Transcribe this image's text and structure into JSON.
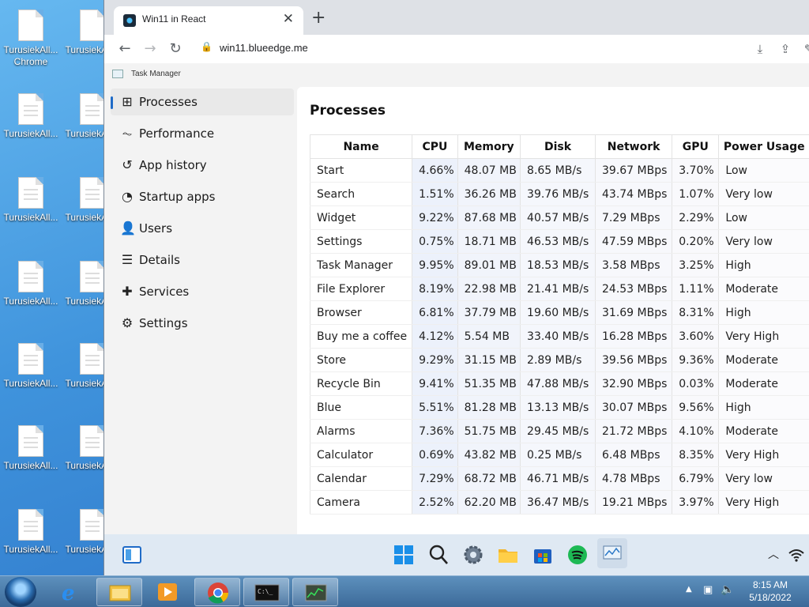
{
  "desktop": {
    "icons": [
      {
        "label": "TurusiekAll..."
      },
      {
        "label": "TurusiekAll..."
      },
      {
        "label": "TurusiekAll..."
      },
      {
        "label": "TurusiekAll..."
      },
      {
        "label": "TurusiekAll..."
      },
      {
        "label": "TurusiekAll..."
      },
      {
        "label": "TurusiekAll..."
      },
      {
        "label": "TurusiekAll..."
      },
      {
        "label": "TurusiekAll..."
      },
      {
        "label": "TurusiekAll..."
      },
      {
        "label": "TurusiekAll..."
      },
      {
        "label": "TurusiekAll..."
      }
    ],
    "chrome_label": "Chrome"
  },
  "browser": {
    "tab_title": "Win11 in React",
    "url": "win11.blueedge.me"
  },
  "taskmanager": {
    "title": "Task Manager",
    "nav": [
      {
        "label": "Processes",
        "icon": "grid-icon",
        "glyph": "⊞"
      },
      {
        "label": "Performance",
        "icon": "pulse-icon",
        "glyph": "⏦"
      },
      {
        "label": "App history",
        "icon": "history-icon",
        "glyph": "↺"
      },
      {
        "label": "Startup apps",
        "icon": "speedometer-icon",
        "glyph": "◔"
      },
      {
        "label": "Users",
        "icon": "user-icon",
        "glyph": "👤"
      },
      {
        "label": "Details",
        "icon": "list-icon",
        "glyph": "☰"
      },
      {
        "label": "Services",
        "icon": "puzzle-icon",
        "glyph": "✚"
      },
      {
        "label": "Settings",
        "icon": "gear-icon",
        "glyph": "⚙"
      }
    ],
    "heading": "Processes",
    "columns": [
      "Name",
      "CPU",
      "Memory",
      "Disk",
      "Network",
      "GPU",
      "Power Usage"
    ],
    "rows": [
      [
        "Start",
        "4.66%",
        "48.07 MB",
        "8.65 MB/s",
        "39.67 MBps",
        "3.70%",
        "Low"
      ],
      [
        "Search",
        "1.51%",
        "36.26 MB",
        "39.76 MB/s",
        "43.74 MBps",
        "1.07%",
        "Very low"
      ],
      [
        "Widget",
        "9.22%",
        "87.68 MB",
        "40.57 MB/s",
        "7.29 MBps",
        "2.29%",
        "Low"
      ],
      [
        "Settings",
        "0.75%",
        "18.71 MB",
        "46.53 MB/s",
        "47.59 MBps",
        "0.20%",
        "Very low"
      ],
      [
        "Task Manager",
        "9.95%",
        "89.01 MB",
        "18.53 MB/s",
        "3.58 MBps",
        "3.25%",
        "High"
      ],
      [
        "File Explorer",
        "8.19%",
        "22.98 MB",
        "21.41 MB/s",
        "24.53 MBps",
        "1.11%",
        "Moderate"
      ],
      [
        "Browser",
        "6.81%",
        "37.79 MB",
        "19.60 MB/s",
        "31.69 MBps",
        "8.31%",
        "High"
      ],
      [
        "Buy me a coffee",
        "4.12%",
        "5.54 MB",
        "33.40 MB/s",
        "16.28 MBps",
        "3.60%",
        "Very High"
      ],
      [
        "Store",
        "9.29%",
        "31.15 MB",
        "2.89 MB/s",
        "39.56 MBps",
        "9.36%",
        "Moderate"
      ],
      [
        "Recycle Bin",
        "9.41%",
        "51.35 MB",
        "47.88 MB/s",
        "32.90 MBps",
        "0.03%",
        "Moderate"
      ],
      [
        "Blue",
        "5.51%",
        "81.28 MB",
        "13.13 MB/s",
        "30.07 MBps",
        "9.56%",
        "High"
      ],
      [
        "Alarms",
        "7.36%",
        "51.75 MB",
        "29.45 MB/s",
        "21.72 MBps",
        "4.10%",
        "Moderate"
      ],
      [
        "Calculator",
        "0.69%",
        "43.82 MB",
        "0.25 MB/s",
        "6.48 MBps",
        "8.35%",
        "Very High"
      ],
      [
        "Calendar",
        "7.29%",
        "68.72 MB",
        "46.71 MB/s",
        "4.78 MBps",
        "6.79%",
        "Very low"
      ],
      [
        "Camera",
        "2.52%",
        "62.20 MB",
        "36.47 MB/s",
        "19.21 MBps",
        "3.97%",
        "Very High"
      ]
    ]
  },
  "taskbar7": {
    "time": "8:15 AM",
    "date": "5/18/2022"
  }
}
